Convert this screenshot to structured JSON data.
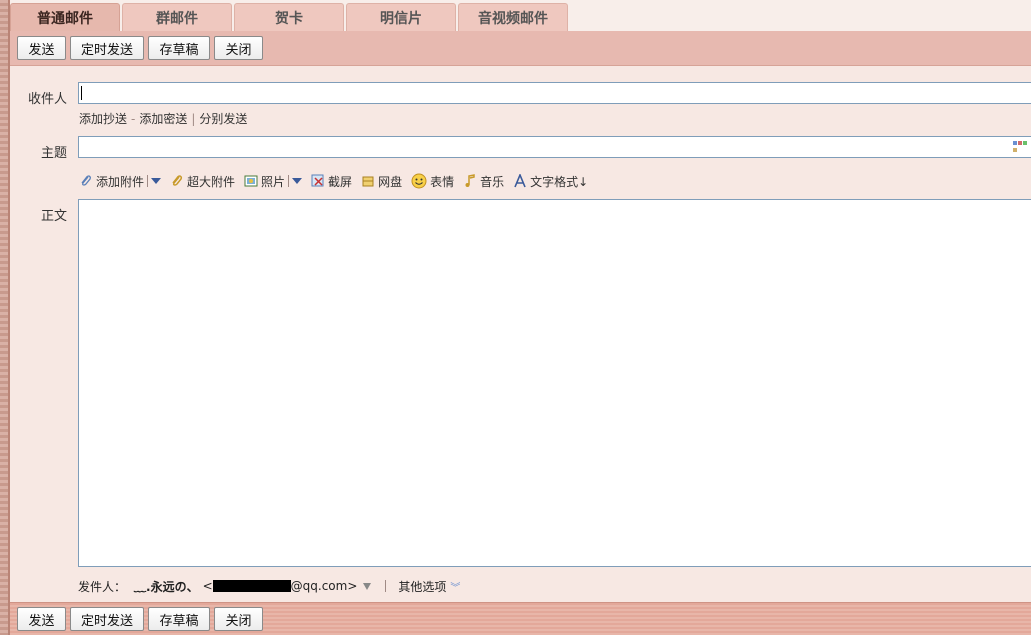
{
  "tabs": [
    {
      "label": "普通邮件",
      "active": true
    },
    {
      "label": "群邮件",
      "active": false
    },
    {
      "label": "贺卡",
      "active": false
    },
    {
      "label": "明信片",
      "active": false
    },
    {
      "label": "音视频邮件",
      "active": false
    }
  ],
  "toolbar": {
    "send_label": "发送",
    "scheduled_send_label": "定时发送",
    "save_draft_label": "存草稿",
    "close_label": "关闭"
  },
  "form": {
    "recipient_label": "收件人",
    "recipient_value": "",
    "add_cc_label": "添加抄送",
    "add_bcc_label": "添加密送",
    "separate_send_label": "分别发送",
    "subject_label": "主题",
    "subject_value": "",
    "body_label": "正文",
    "body_value": ""
  },
  "attach_tools": {
    "add_attachment": "添加附件",
    "large_attachment": "超大附件",
    "photo": "照片",
    "screenshot": "截屏",
    "netdisk": "网盘",
    "emoji": "表情",
    "music": "音乐",
    "text_format": "文字格式↓"
  },
  "sender": {
    "label": "发件人：",
    "name": "﹏.永远の、",
    "email_prefix": "<",
    "email_suffix": "@qq.com>",
    "other_options": "其他选项"
  },
  "colors": {
    "toolbar_bg": "#e7b9b0",
    "form_bg": "#f7e8e3",
    "field_border": "#7f9db9",
    "link_blue": "#3a5a9a"
  }
}
